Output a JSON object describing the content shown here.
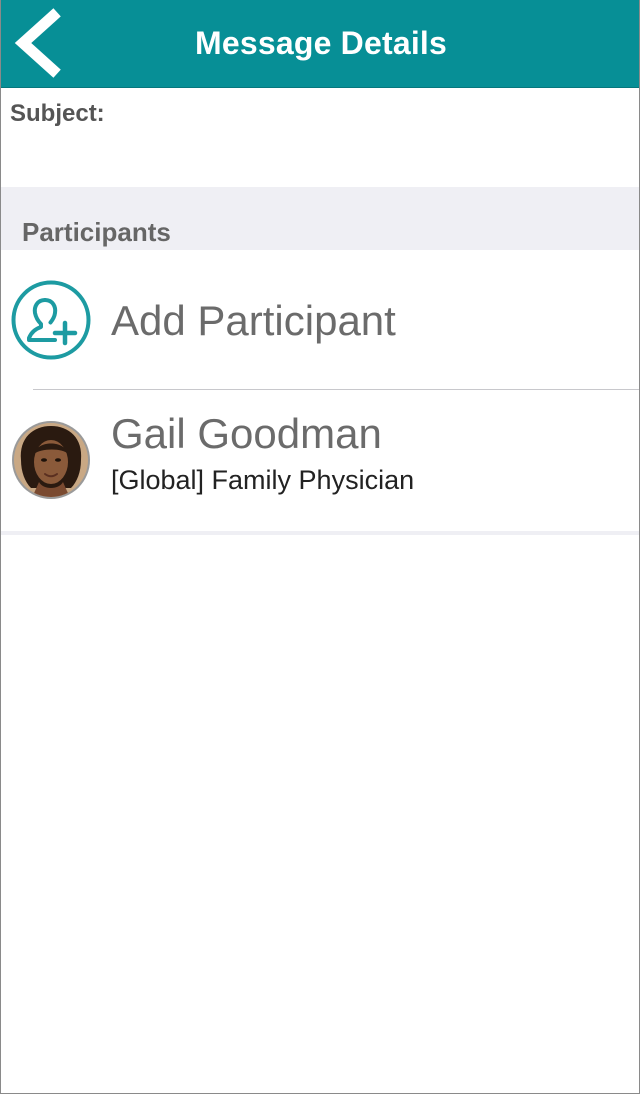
{
  "navbar": {
    "title": "Message Details",
    "back_icon": "chevron-left-icon",
    "color": "#078f96"
  },
  "subject": {
    "label": "Subject:",
    "value": ""
  },
  "participants_section": {
    "header": "Participants",
    "add": {
      "label": "Add Participant",
      "icon": "add-user-icon"
    },
    "items": [
      {
        "name": "Gail Goodman",
        "role": "[Global] Family Physician",
        "avatar": "avatar-photo"
      }
    ]
  }
}
